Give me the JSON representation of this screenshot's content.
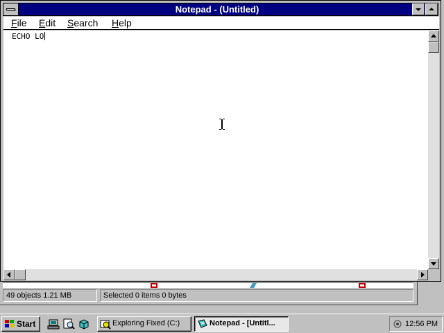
{
  "notepad": {
    "title": "Notepad - (Untitled)",
    "menu": {
      "file": "File",
      "edit": "Edit",
      "search": "Search",
      "help": "Help"
    },
    "document_text": "ECHO LO"
  },
  "explorer": {
    "status_objects": "49 objects  1.21 MB",
    "status_selected": "Selected 0 items  0 bytes"
  },
  "taskbar": {
    "start_label": "Start",
    "quick_launch": [
      "network-icon",
      "find-icon",
      "cube-icon"
    ],
    "tasks": [
      {
        "label": "Exploring Fixed (C:)",
        "icon": "explorer-icon",
        "active": false
      },
      {
        "label": "Notepad - [Untitl...",
        "icon": "notepad-icon",
        "active": true
      }
    ],
    "clock": "12:56 PM"
  },
  "colors": {
    "titlebar": "#000080",
    "face": "#c0c0c0",
    "window": "#ffffff"
  }
}
